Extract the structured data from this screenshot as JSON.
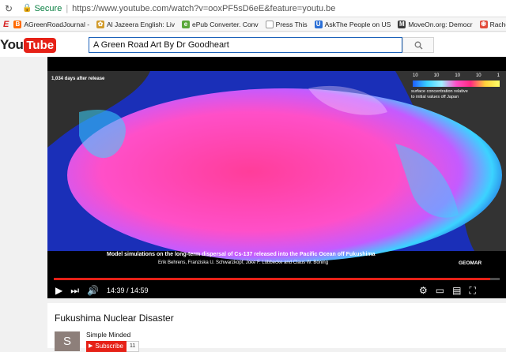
{
  "browser": {
    "secure_label": "Secure",
    "separator": "|",
    "url": "https://www.youtube.com/watch?v=ooxPF5sD6eE&feature=youtu.be"
  },
  "bookmarks": [
    {
      "label": "AGreenRoadJournal -",
      "icon": "blogger-icon",
      "color": "#ff6a00"
    },
    {
      "label": "Al Jazeera English: Liv",
      "icon": "aljazeera-icon",
      "color": "#d19b2b"
    },
    {
      "label": "ePub Converter. Conv",
      "icon": "epub-icon",
      "color": "#5aa83a"
    },
    {
      "label": "Press This",
      "icon": "page-icon",
      "color": "#9a9a9a"
    },
    {
      "label": "AskThe People on US",
      "icon": "u-icon",
      "color": "#2a6fd6"
    },
    {
      "label": "MoveOn.org: Democr",
      "icon": "moveon-icon",
      "color": "#3b3b3b"
    },
    {
      "label": "Rachel Ma",
      "icon": "nbc-icon",
      "color": "#e24b3b"
    }
  ],
  "youtube": {
    "logo_you": "You",
    "logo_tube": "Tube",
    "search_value": "A Green Road Art By Dr Goodheart"
  },
  "video": {
    "days_label": "1,034 days after release",
    "scale_ticks": [
      "10",
      "10",
      "10",
      "10",
      "1"
    ],
    "scale_label_1": "surface concentration relative",
    "scale_label_2": "to initial values off Japan",
    "caption_1": "Model simulations on the long-term dispersal of Cs-137 released into the Pacific Ocean off Fukushima",
    "caption_2": "Erik Behrens, Franziska U. Schwarzkopf, Joke F. Lübbecke and Claus W. Böning",
    "credit": "GEOMAR",
    "time": "14:39 / 14:59",
    "progress": 0.978
  },
  "info": {
    "title": "Fukushima Nuclear Disaster",
    "avatar_letter": "S",
    "channel": "Simple Minded",
    "subscribe_label": "Subscribe",
    "subscriber_count": "11"
  },
  "colors": {
    "accent": "#e62117",
    "link": "#1c62b9"
  }
}
